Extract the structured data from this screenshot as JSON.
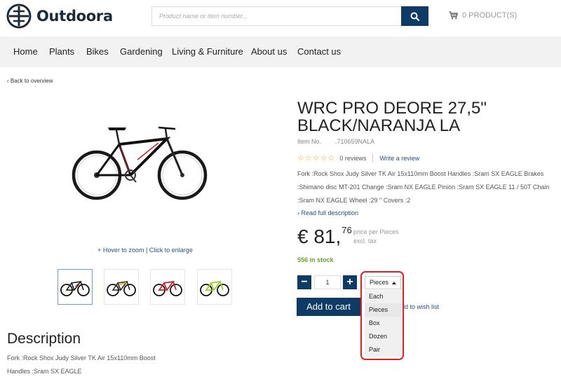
{
  "brand": {
    "name": "Outdoora"
  },
  "search": {
    "placeholder": "Product name or item number..."
  },
  "cart": {
    "label": "0 PRODUCT(S)"
  },
  "nav": {
    "items": [
      "Home",
      "Plants",
      "Bikes",
      "Gardening",
      "Living & Furniture",
      "About us",
      "Contact us"
    ]
  },
  "back": {
    "label": "‹  Back to overview"
  },
  "gallery": {
    "zoom_hint": "+ Hover to zoom | Click to enlarge",
    "thumbnails": [
      {
        "icon": "bike-black-red-icon",
        "color": "#c0262b"
      },
      {
        "icon": "bike-yellow-icon",
        "color": "#d8c41e"
      },
      {
        "icon": "bike-red-icon",
        "color": "#c0262b"
      },
      {
        "icon": "bike-green-icon",
        "color": "#9bd12a"
      }
    ]
  },
  "product": {
    "title": "WRC PRO DEORE 27,5\" BLACK/NARANJA LA",
    "item_no_label": "Item No.",
    "item_no": ".710659NALA",
    "rating_stars": 0,
    "reviews": "0 reviews",
    "write_review": "Write a review",
    "specs": [
      "Fork   :Rock Shox Judy Silver TK Air 15x110mm Boost Handles   :Sram SX EAGLE Brakes",
      ":Shimano disc MT-201 Change   :Sram NX EAGLE Pinion   :Sram SX EAGLE 11 / 50T Chain",
      ":Sram NX EAGLE Wheel   :29 \" Covers   :2"
    ],
    "read_full": "› Read full description",
    "price_main": "€ 81,",
    "price_cents": "76",
    "price_per": "price per Pieces",
    "price_tax": "excl. tax",
    "stock": "556 in stock",
    "quantity": "1",
    "qty_minus": "−",
    "qty_plus": "+",
    "unit": {
      "selected": "Pieces",
      "options": [
        "Each",
        "Pieces",
        "Box",
        "Dozen",
        "Pair"
      ]
    },
    "add_to_cart": "Add to cart",
    "wishlist": "dd to wish list"
  },
  "description": {
    "title": "Description",
    "lines": [
      "Fork   :Rock Shox Judy Silver TK Air 15x110mm Boost",
      "Handles   :Sram SX EAGLE"
    ]
  },
  "colors": {
    "primary": "#0d3b66",
    "stock": "#5ea530",
    "highlight": "#e02020",
    "star": "#f0a500"
  }
}
